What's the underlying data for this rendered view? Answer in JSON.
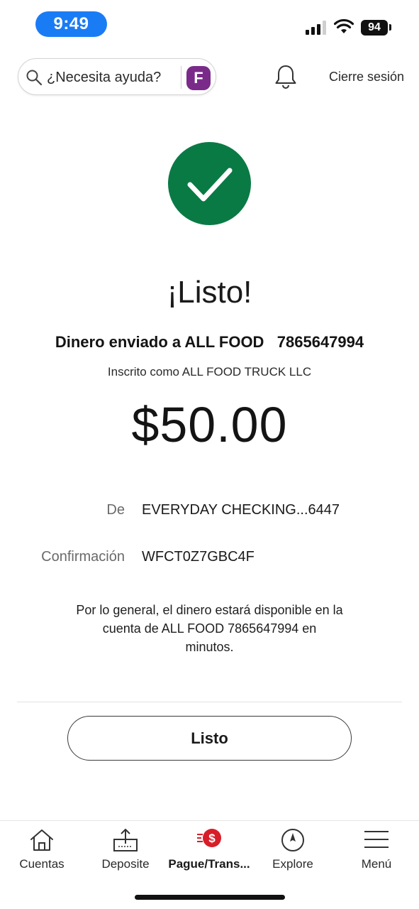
{
  "status_bar": {
    "time": "9:49",
    "battery": "94"
  },
  "header": {
    "search_placeholder": "¿Necesita ayuda?",
    "assistant_icon_letter": "F",
    "logout_label": "Cierre sesión"
  },
  "confirmation": {
    "headline": "¡Listo!",
    "sent_to": "Dinero enviado a ALL FOOD   7865647994",
    "registered_as": "Inscrito como ALL FOOD TRUCK LLC",
    "amount": "$50.00",
    "from_label": "De",
    "from_value": "EVERYDAY CHECKING...6447",
    "confirmation_label": "Confirmación",
    "confirmation_value": "WFCT0Z7GBC4F",
    "availability_note": "Por lo general, el dinero estará disponible en la\ncuenta de ALL FOOD   7865647994 en\nminutos.",
    "done_button": "Listo"
  },
  "tabbar": {
    "items": [
      {
        "label": "Cuentas",
        "icon": "home-icon"
      },
      {
        "label": "Deposite",
        "icon": "deposit-icon"
      },
      {
        "label": "Pague/Trans...",
        "icon": "pay-transfer-icon",
        "active": true
      },
      {
        "label": "Explore",
        "icon": "compass-icon"
      },
      {
        "label": "Menú",
        "icon": "hamburger-menu-icon"
      }
    ]
  },
  "colors": {
    "success_green": "#0a7a45",
    "accent_red": "#d71e28",
    "assistant_purple": "#7a2b8a",
    "time_pill_blue": "#1a7cf5"
  }
}
